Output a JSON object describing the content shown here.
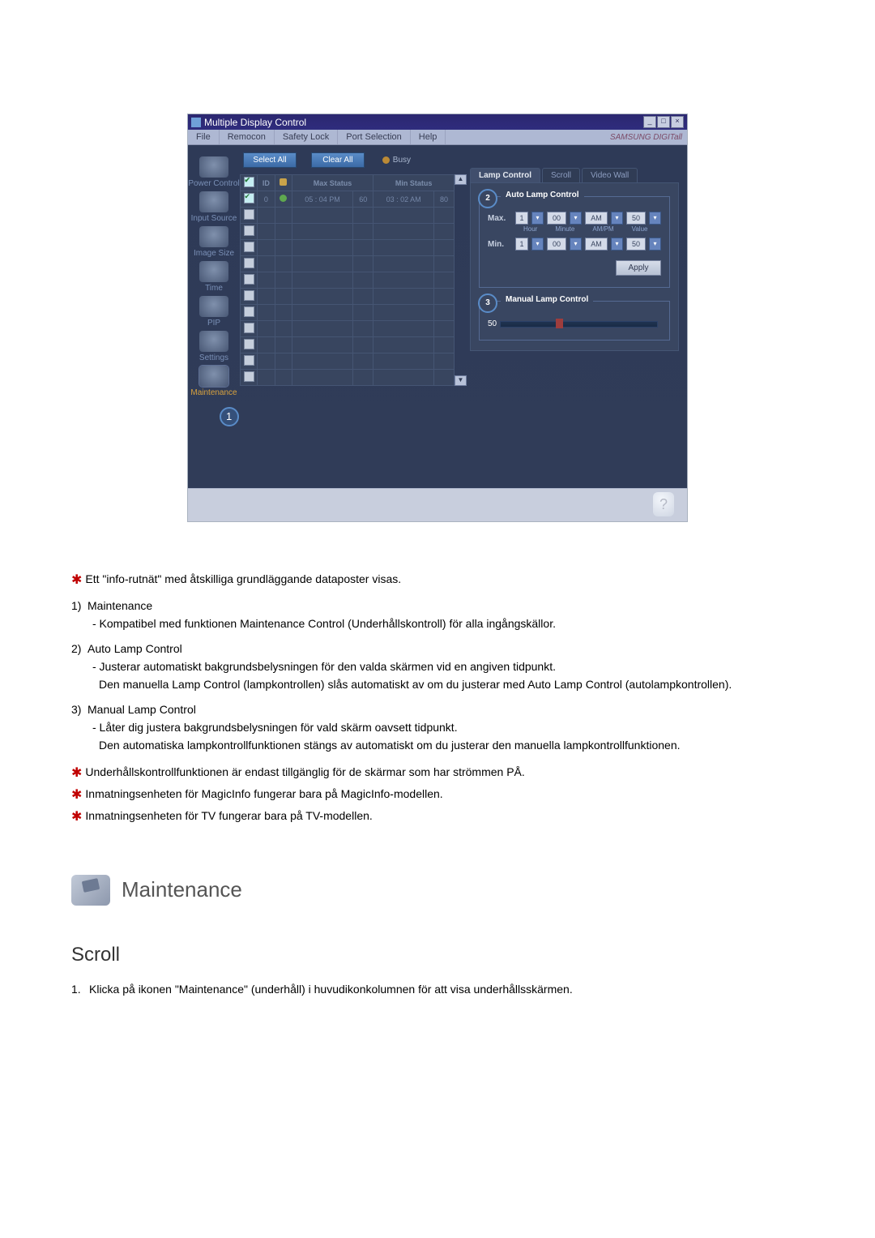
{
  "window": {
    "title": "Multiple Display Control",
    "brand": "SAMSUNG DIGITall"
  },
  "menu": {
    "file": "File",
    "remocon": "Remocon",
    "safety": "Safety Lock",
    "port": "Port Selection",
    "help": "Help"
  },
  "sidebar": {
    "power": "Power Control",
    "input": "Input Source",
    "image": "Image Size",
    "time": "Time",
    "pip": "PIP",
    "settings": "Settings",
    "maint": "Maintenance"
  },
  "toolbar": {
    "select_all": "Select All",
    "clear_all": "Clear All",
    "busy": "Busy"
  },
  "grid": {
    "headers": {
      "id": "ID",
      "max": "Max Status",
      "min": "Min Status"
    },
    "row": {
      "id": "0",
      "max_time": "05 : 04 PM",
      "max_v": "60",
      "min_time": "03 : 02 AM",
      "min_v": "80"
    }
  },
  "tabs": {
    "lamp": "Lamp Control",
    "scroll": "Scroll",
    "video": "Video Wall"
  },
  "auto": {
    "title": "Auto Lamp Control",
    "max": "Max.",
    "min": "Min.",
    "hour": "1",
    "minute": "00",
    "ampm": "AM",
    "value": "50",
    "l_hour": "Hour",
    "l_min": "Minute",
    "l_ampm": "AM/PM",
    "l_val": "Value",
    "apply": "Apply"
  },
  "manual": {
    "title": "Manual Lamp Control",
    "value": "50"
  },
  "callouts": {
    "one": "1",
    "two": "2",
    "three": "3"
  },
  "doc": {
    "b0": "Ett \"info-rutnät\" med åtskilliga grundläggande dataposter visas.",
    "i1": "1)",
    "t1": "Maintenance",
    "d1": "- Kompatibel med funktionen Maintenance Control (Underhållskontroll) för alla ingångskällor.",
    "i2": "2)",
    "t2": "Auto Lamp Control",
    "d2a": "- Justerar automatiskt bakgrundsbelysningen för den valda skärmen vid en angiven tidpunkt.",
    "d2b": "Den manuella Lamp Control (lampkontrollen) slås automatiskt av om du justerar med Auto Lamp Control (autolampkontrollen).",
    "i3": "3)",
    "t3": "Manual Lamp Control",
    "d3a": "- Låter dig justera bakgrundsbelysningen för vald skärm oavsett tidpunkt.",
    "d3b": "Den automatiska lampkontrollfunktionen stängs av automatiskt om du justerar den manuella lampkontrollfunktionen.",
    "n1": "Underhållskontrollfunktionen är endast tillgänglig för de skärmar som har strömmen PÅ.",
    "n2": "Inmatningsenheten för MagicInfo fungerar bara på MagicInfo-modellen.",
    "n3": "Inmatningsenheten för TV fungerar bara på TV-modellen.",
    "section": "Maintenance",
    "subheader": "Scroll",
    "step_n": "1.",
    "step": "Klicka på ikonen \"Maintenance\" (underhåll) i huvudikonkolumnen för att visa underhållsskärmen."
  },
  "chart_data": {
    "type": "table",
    "columns": [
      "ID",
      "Max Status Time",
      "Max Value",
      "Min Status Time",
      "Min Value"
    ],
    "rows": [
      [
        "0",
        "05 : 04 PM",
        "60",
        "03 : 02 AM",
        "80"
      ]
    ]
  }
}
